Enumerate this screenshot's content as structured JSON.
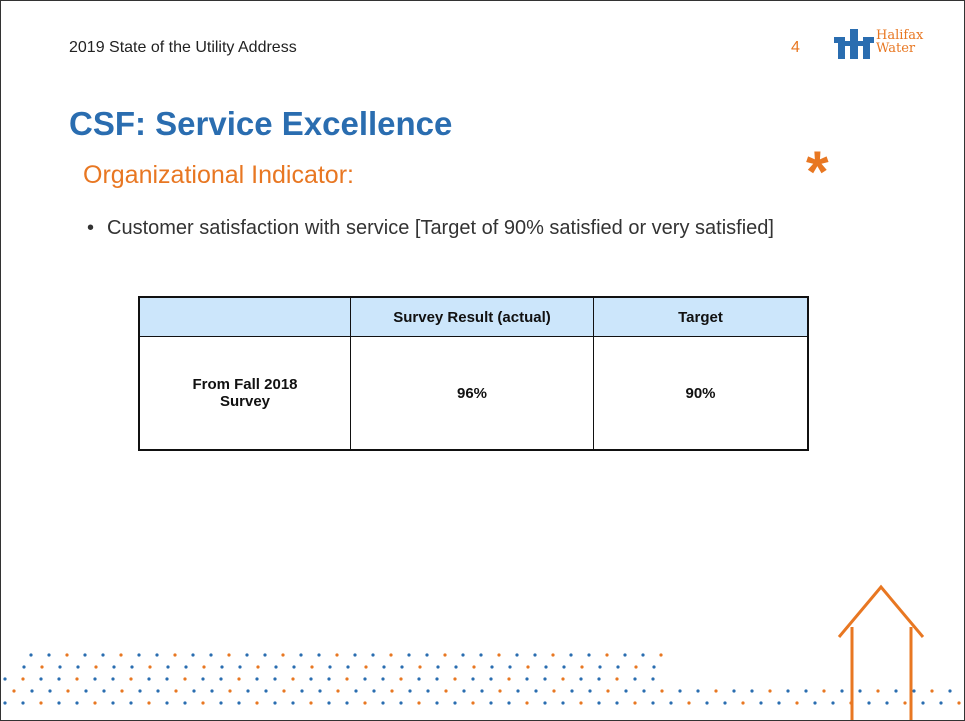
{
  "header": {
    "presentation_title": "2019 State of the Utility Address",
    "page_number": "4",
    "logo_text_line1": "Halifax",
    "logo_text_line2": "Water"
  },
  "slide": {
    "title": "CSF: Service Excellence",
    "subtitle": "Organizational Indicator:",
    "asterisk": "*",
    "bullet_symbol": "•",
    "bullet": "Customer satisfaction with service [Target of 90% satisfied or very satisfied]"
  },
  "table": {
    "headers": [
      "",
      "Survey Result (actual)",
      "Target"
    ],
    "rows": [
      [
        "From Fall 2018 Survey",
        "96%",
        "90%"
      ]
    ]
  },
  "colors": {
    "title_blue": "#2a6db0",
    "accent_orange": "#e87722",
    "header_fill": "#cce6fb",
    "dot_blue": "#2a6db0",
    "dot_orange": "#e87722"
  },
  "icons": {
    "logo": "halifax-water-logo",
    "decoration": "dotted-house-decoration"
  }
}
